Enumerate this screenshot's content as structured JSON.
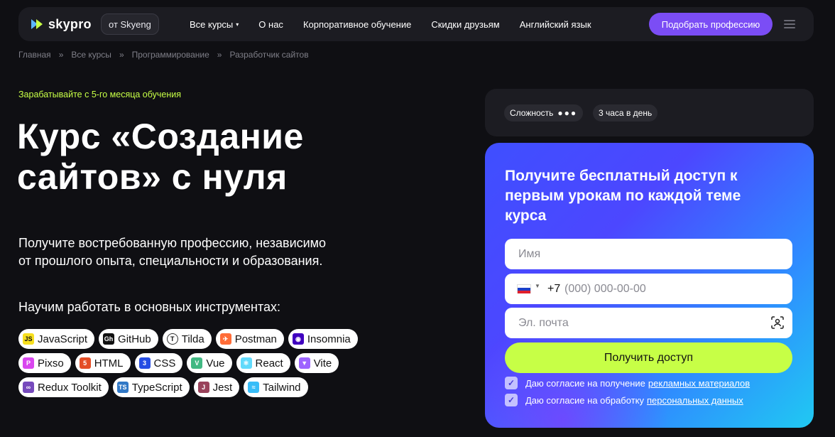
{
  "header": {
    "logo": "skypro",
    "skyeng_label": "от Skyeng",
    "nav": [
      {
        "label": "Все курсы",
        "caret": "▾"
      },
      {
        "label": "О нас"
      },
      {
        "label": "Корпоративное обучение"
      },
      {
        "label": "Скидки друзьям"
      },
      {
        "label": "Английский язык"
      }
    ],
    "cta_label": "Подобрать профессию",
    "menu_icon": "hamburger-icon"
  },
  "breadcrumbs": {
    "items": [
      "Главная",
      "Все курсы",
      "Программирование",
      "Разработчик сайтов"
    ],
    "separator": "»"
  },
  "hero": {
    "earn_text": "Зарабатывайте с 5-го месяца обучения",
    "title_line1": "Курс «Создание",
    "title_line2": "сайтов» с нуля",
    "subtitle_line1": "Получите востребованную профессию, независимо",
    "subtitle_line2": "от прошлого опыта, специальности и образования.",
    "tools_title": "Научим работать в основных инструментах:",
    "tools": [
      [
        {
          "label": "JavaScript",
          "icon": "javascript-icon",
          "color": "#f7df1e",
          "glyph": "JS"
        },
        {
          "label": "GitHub",
          "icon": "github-icon",
          "color": "#111111",
          "glyph": "Gh"
        },
        {
          "label": "Tilda",
          "icon": "tilda-icon",
          "color": "#ffffff",
          "glyph": "T"
        },
        {
          "label": "Postman",
          "icon": "postman-icon",
          "color": "#ff6c37",
          "glyph": "✈"
        },
        {
          "label": "Insomnia",
          "icon": "insomnia-icon",
          "color": "#4000bf",
          "glyph": "◉"
        }
      ],
      [
        {
          "label": "Pixso",
          "icon": "pixso-icon",
          "color": "#d946ef",
          "glyph": "P"
        },
        {
          "label": "HTML",
          "icon": "html-icon",
          "color": "#e44d26",
          "glyph": "5"
        },
        {
          "label": "CSS",
          "icon": "css-icon",
          "color": "#264de4",
          "glyph": "3"
        },
        {
          "label": "Vue",
          "icon": "vue-icon",
          "color": "#41b883",
          "glyph": "V"
        },
        {
          "label": "React",
          "icon": "react-icon",
          "color": "#61dafb",
          "glyph": "⚛"
        },
        {
          "label": "Vite",
          "icon": "vite-icon",
          "color": "#9d64ff",
          "glyph": "▼"
        }
      ],
      [
        {
          "label": "Redux Toolkit",
          "icon": "redux-icon",
          "color": "#764abc",
          "glyph": "∞"
        },
        {
          "label": "TypeScript",
          "icon": "typescript-icon",
          "color": "#3178c6",
          "glyph": "TS"
        },
        {
          "label": "Jest",
          "icon": "jest-icon",
          "color": "#99425b",
          "glyph": "J"
        },
        {
          "label": "Tailwind",
          "icon": "tailwind-icon",
          "color": "#38bdf8",
          "glyph": "≈"
        }
      ]
    ]
  },
  "course_info": {
    "difficulty_label": "Сложность",
    "difficulty_dots": "●●●",
    "schedule": "3 часа в день"
  },
  "form": {
    "title": "Получите бесплатный доступ к первым урокам по каждой теме курса",
    "name_placeholder": "Имя",
    "phone_code": "+7",
    "phone_placeholder": "(000) 000-00-00",
    "email_placeholder": "Эл. почта",
    "submit_label": "Получить доступ",
    "consent1_text": "Даю согласие на получение",
    "consent1_link": "рекламных материалов",
    "consent2_text": "Даю согласие на обработку",
    "consent2_link": "персональных данных",
    "check_mark": "✓"
  },
  "colors": {
    "accent_lime": "#c7ff46",
    "accent_purple": "#7b4df5",
    "background": "#0f0f13"
  }
}
